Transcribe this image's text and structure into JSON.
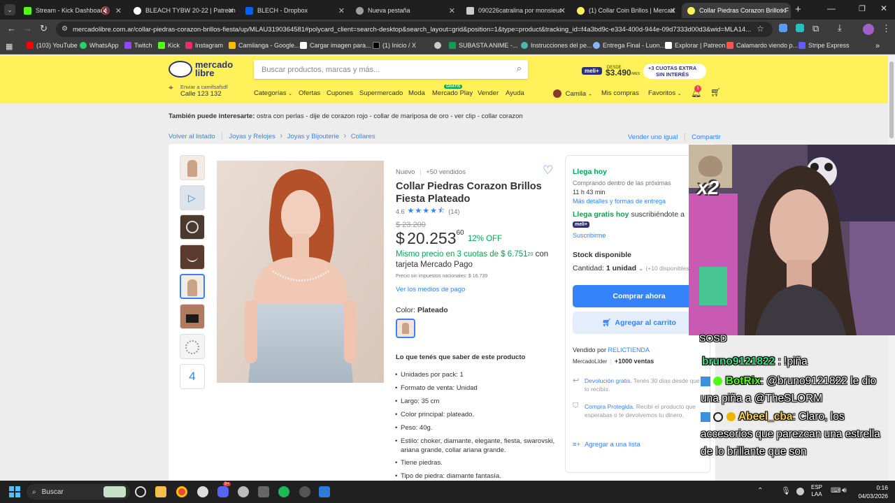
{
  "tabs": [
    {
      "title": "Stream - Kick Dashboard",
      "color": "#53fc18"
    },
    {
      "title": "BLEACH TYBW 20-22 | Patreon",
      "color": "#ffffff"
    },
    {
      "title": "BLECH - Dropbox",
      "color": "#0061ff"
    },
    {
      "title": "Nueva pestaña",
      "color": "#9aa0a6"
    },
    {
      "title": "090226catralina por monsieur-",
      "color": "#cccccc"
    },
    {
      "title": "(1) Collar Coin Brillos | Mercad",
      "color": "#fff159"
    },
    {
      "title": "Collar Piedras Corazon Brillos F",
      "color": "#fff159"
    }
  ],
  "url": "mercadolibre.com.ar/collar-piedras-corazon-brillos-fiesta/up/MLAU3190364581#polycard_client=search-desktop&search_layout=grid&position=1&type=product&tracking_id=f4a3bd9c-e334-400d-944e-09d7333d00d3&wid=MLA14...",
  "bookmarks": [
    {
      "label": "(103) YouTube",
      "color": "#ff0000"
    },
    {
      "label": "WhatsApp",
      "color": "#25d366"
    },
    {
      "label": "Twitch",
      "color": "#9146ff"
    },
    {
      "label": "Kick",
      "color": "#53fc18"
    },
    {
      "label": "Instagram",
      "color": "#e1306c"
    },
    {
      "label": "Camilanga - Google...",
      "color": "#fbbc04"
    },
    {
      "label": "Cargar imagen para...",
      "color": "#ffffff"
    },
    {
      "label": "(1) Inicio / X",
      "color": "#000000"
    },
    {
      "label": "",
      "color": "#cccccc"
    },
    {
      "label": "SUBASTA ANIME -...",
      "color": "#0f9d58"
    },
    {
      "label": "Instrucciones del pe...",
      "color": "#4db6ac"
    },
    {
      "label": "Entrega Final - Luon...",
      "color": "#8ab4f8"
    },
    {
      "label": "Explorar | Patreon",
      "color": "#ffffff"
    },
    {
      "label": "Calamardo viendo p...",
      "color": "#ff5252"
    },
    {
      "label": "Stripe Express",
      "color": "#635bff"
    }
  ],
  "ml": {
    "logo_line1": "mercado",
    "logo_line2": "libre",
    "search_placeholder": "Buscar productos, marcas y más...",
    "promo_meli": "meli+",
    "promo_desde": "DESDE",
    "promo_price": "$3.490",
    "promo_per": "/MES",
    "promo_cuotas": "+3 CUOTAS EXTRA",
    "promo_interes": "SIN INTERÉS",
    "ship_line1": "Enviar a camifsafsdf",
    "ship_line2": "Calle 123 132",
    "nav": [
      "Categorías",
      "Ofertas",
      "Cupones",
      "Supermercado",
      "Moda",
      "Mercado Play",
      "Vender",
      "Ayuda"
    ],
    "nav_gratis": "GRATIS",
    "user": "Camila",
    "mis_compras": "Mis compras",
    "favoritos": "Favoritos",
    "notif_count": "1"
  },
  "product": {
    "related_label": "También puede interesarte:",
    "related_items": "ostra con perlas - dije de corazon rojo - collar de mariposa de oro - ver clip - collar corazon",
    "breadcrumb": [
      "Volver al listado",
      "Joyas y Relojes",
      "Joyas y Bijouterie",
      "Collares"
    ],
    "vender_igual": "Vender uno igual",
    "compartir": "Compartir",
    "condition": "Nuevo",
    "sold": "+50 vendidos",
    "title_line1": "Collar Piedras Corazon Brillos",
    "title_line2": "Fiesta Plateado",
    "rating_value": "4.6",
    "rating_stars": 4.6,
    "rating_count": "(14)",
    "old_price": "$ 23.200",
    "price_symbol": "$",
    "price_int": "20.253",
    "price_cents": "60",
    "discount": "12% OFF",
    "cuotas_green": "Mismo precio en 3 cuotas de $ 6.751",
    "cuotas_cents": "20",
    "cuotas_con": "con",
    "cuotas_line2": "tarjeta Mercado Pago",
    "sin_impuestos": "Precio sin impuestos nacionales: $ 16.739",
    "medios_pago": "Ver los medios de pago",
    "color_label": "Color: ",
    "color_value": "Plateado",
    "more_thumbs": "4",
    "features_title": "Lo que tenés que saber de este producto",
    "features": [
      "Unidades por pack: 1",
      "Formato de venta: Unidad",
      "Largo: 35 cm",
      "Color principal: plateado.",
      "Peso: 40g.",
      "Estilo: choker, diamante, elegante, fiesta, swarovski, ariana grande, collar ariana grande.",
      "Tiene piedras.",
      "Tipo de piedra: diamante fantasía."
    ]
  },
  "buybox": {
    "llega_hoy": "Llega hoy",
    "comprando": "Comprando dentro de las próximas",
    "tiempo": "11 h 43 min",
    "mas_detalles": "Más detalles y formas de entrega",
    "llega_gratis": "Llega gratis hoy",
    "suscribiendote": " suscribiéndote a",
    "meli_badge": "meli+",
    "suscribirme": "Suscribirme",
    "stock": "Stock disponible",
    "cantidad_label": "Cantidad: ",
    "cantidad_value": "1 unidad",
    "disponibles": "(+10 disponibles)",
    "comprar": "Comprar ahora",
    "agregar": "Agregar al carrito",
    "vendido_por": "Vendido por ",
    "vendedor": "RELICTIENDA",
    "lider": "MercadoLíder",
    "ventas": "+1000 ventas",
    "devolucion_link": "Devolución gratis.",
    "devolucion_text": " Tenés 30 días desde que lo recibís.",
    "protegida_link": "Compra Protegida.",
    "protegida_text": " Recibí el producto que esperabas o te devolvemos tu dinero.",
    "agregar_lista": "Agregar a una lista"
  },
  "overlay": {
    "multiplier": "x2",
    "chat": [
      {
        "user": "",
        "text": "SOSD",
        "color": "#ffffff"
      },
      {
        "user": "bruno9121822",
        "text": ": !piña",
        "color": "#3ddc84"
      },
      {
        "user": "BotRix",
        "text": ": @bruno9121822 le dio una piña a @TheSLORM",
        "color": "#53fc18"
      },
      {
        "user": "Abeel_cba",
        "text": ": Claro, los accesorios que parezcan una estrella de lo brillante que son",
        "color": "#ffd24d"
      }
    ]
  },
  "taskbar": {
    "search": "Buscar",
    "lang1": "ESP",
    "lang2": "LAA",
    "time": "0:16",
    "date": "04/03/2026",
    "discord_badge": "9+"
  }
}
